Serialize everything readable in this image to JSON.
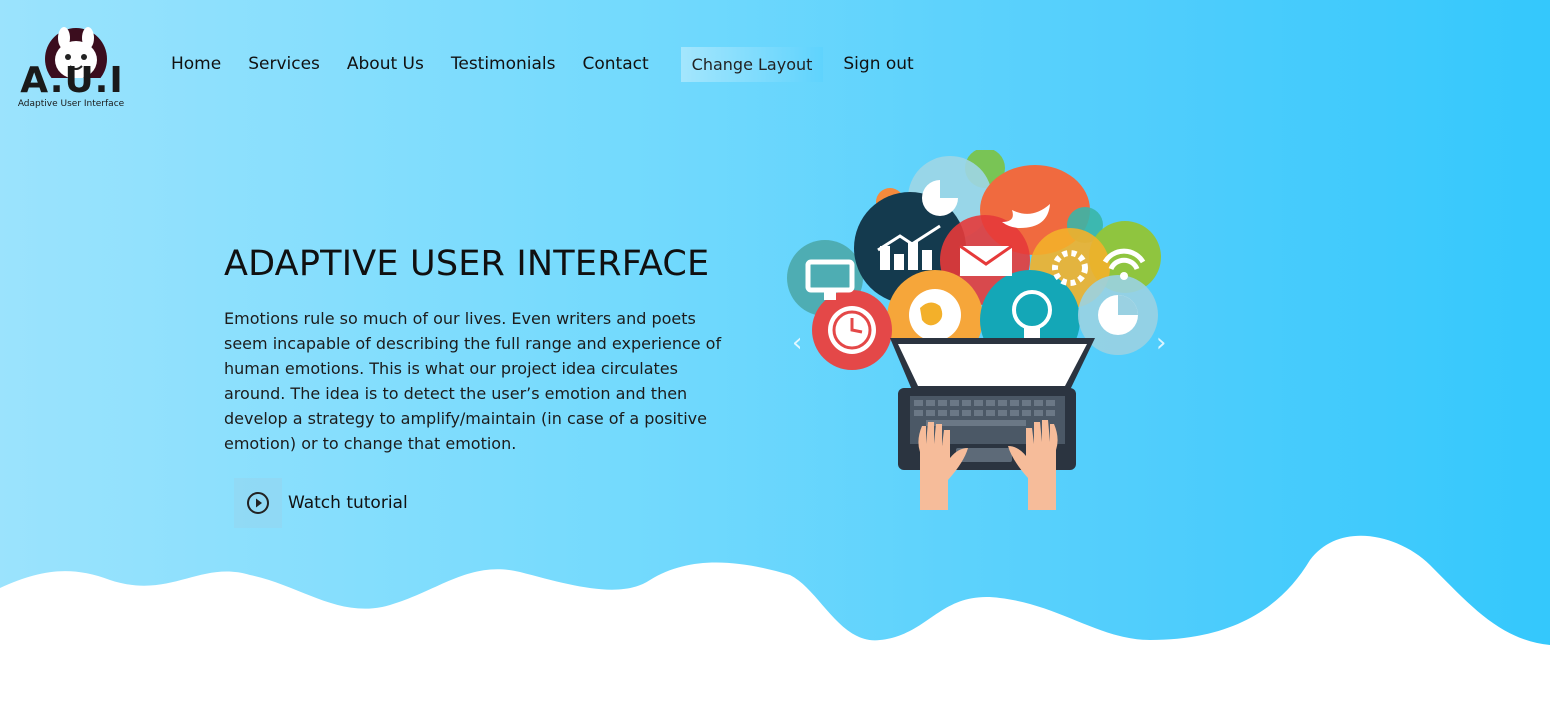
{
  "logo": {
    "letters": "A.U.I",
    "tagline": "Adaptive User Interface"
  },
  "nav": {
    "items": [
      "Home",
      "Services",
      "About Us",
      "Testimonials",
      "Contact"
    ],
    "change_layout": "Change Layout",
    "sign_out": "Sign out"
  },
  "hero": {
    "title": "ADAPTIVE USER INTERFACE",
    "description": "Emotions rule so much of our lives. Even writers and poets seem incapable of describing the full range and experience of human emotions. This is what our project idea circulates around. The idea is to detect the user’s emotion and then develop a strategy to amplify/maintain (in case of a positive emotion) or to change that emotion.",
    "watch_label": "Watch tutorial"
  },
  "carousel": {
    "prev_icon": "chevron-left-icon",
    "next_icon": "chevron-right-icon"
  },
  "colors": {
    "gradient_start": "#9be3fd",
    "gradient_end": "#34c8fc"
  }
}
